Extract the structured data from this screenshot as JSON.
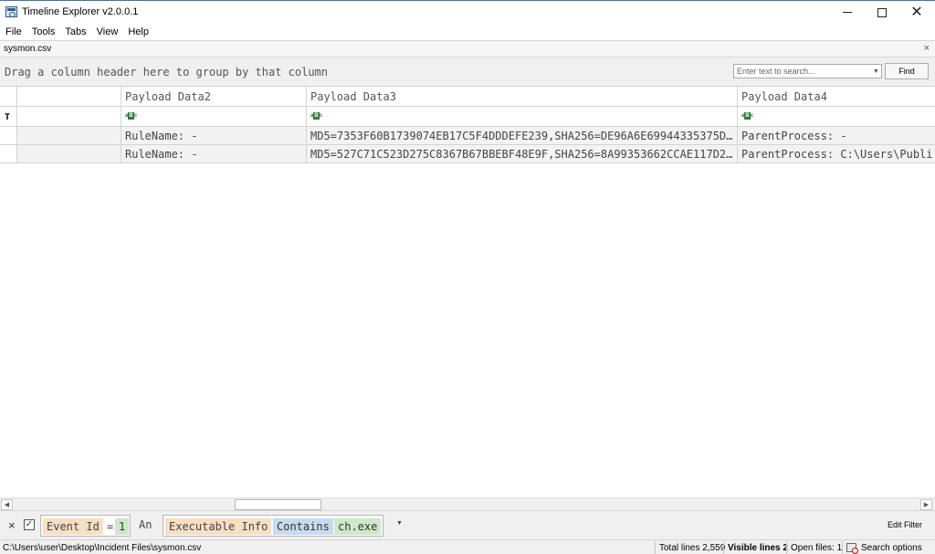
{
  "window": {
    "title": "Timeline Explorer v2.0.0.1"
  },
  "menu": [
    "File",
    "Tools",
    "Tabs",
    "View",
    "Help"
  ],
  "doc_tab": {
    "name": "sysmon.csv",
    "close_glyph": "×"
  },
  "group_panel": {
    "hint": "Drag a column header here to group by that column"
  },
  "search": {
    "placeholder": "Enter text to search...",
    "value": "",
    "find_label": "Find"
  },
  "grid": {
    "columns": [
      "",
      "",
      "Payload Data2",
      "Payload Data3",
      "Payload Data4"
    ],
    "rows": [
      {
        "c1": "",
        "payload2": "RuleName: -",
        "payload3": "MD5=7353F60B1739074EB17C5F4DDDEFE239,SHA256=DE96A6E69944335375D…",
        "payload4": "ParentProcess: -"
      },
      {
        "c1": "",
        "payload2": "RuleName: -",
        "payload3": "MD5=527C71C523D275C8367B67BBEBF48E9F,SHA256=8A99353662CCAE117D2…",
        "payload4": "ParentProcess: C:\\Users\\Publi"
      }
    ]
  },
  "filter": {
    "group1": {
      "field": "Event Id",
      "op": "=",
      "value": "1"
    },
    "joiner": "An",
    "group2": {
      "field": "Executable Info",
      "op": "Contains",
      "value": "ch.exe"
    },
    "edit_label": "Edit Filter",
    "checked_glyph": "✓",
    "close_glyph": "×"
  },
  "status": {
    "path": "C:\\Users\\user\\Desktop\\Incident Files\\sysmon.csv",
    "total": "Total lines 2,559",
    "visible": "Visible lines 2",
    "open_files": "Open files: 1",
    "search_options": "Search options"
  }
}
